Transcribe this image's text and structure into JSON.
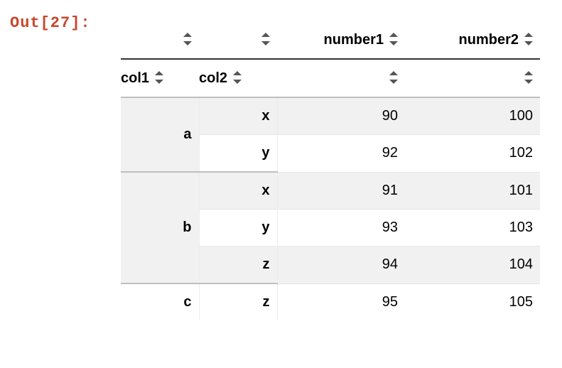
{
  "out_label": "Out[27]:",
  "header": {
    "top": {
      "blank1": "",
      "blank2": "",
      "number1": "number1",
      "number2": "number2"
    },
    "sub": {
      "col1": "col1",
      "col2": "col2",
      "blank1": "",
      "blank2": ""
    }
  },
  "rows": [
    {
      "col1": "a",
      "col2": "x",
      "number1": 90,
      "number2": 100,
      "stripe": true,
      "first_of_group": true,
      "group_rowspan": 2,
      "outer_divider": false
    },
    {
      "col1": "",
      "col2": "y",
      "number1": 92,
      "number2": 102,
      "stripe": false,
      "first_of_group": false,
      "group_rowspan": 0,
      "outer_divider": false
    },
    {
      "col1": "b",
      "col2": "x",
      "number1": 91,
      "number2": 101,
      "stripe": true,
      "first_of_group": true,
      "group_rowspan": 3,
      "outer_divider": true
    },
    {
      "col1": "",
      "col2": "y",
      "number1": 93,
      "number2": 103,
      "stripe": false,
      "first_of_group": false,
      "group_rowspan": 0,
      "outer_divider": false
    },
    {
      "col1": "",
      "col2": "z",
      "number1": 94,
      "number2": 104,
      "stripe": true,
      "first_of_group": false,
      "group_rowspan": 0,
      "outer_divider": false
    },
    {
      "col1": "c",
      "col2": "z",
      "number1": 95,
      "number2": 105,
      "stripe": false,
      "first_of_group": true,
      "group_rowspan": 1,
      "outer_divider": true
    }
  ],
  "chart_data": {
    "type": "table",
    "index_names": [
      "col1",
      "col2"
    ],
    "columns": [
      "number1",
      "number2"
    ],
    "records": [
      {
        "col1": "a",
        "col2": "x",
        "number1": 90,
        "number2": 100
      },
      {
        "col1": "a",
        "col2": "y",
        "number1": 92,
        "number2": 102
      },
      {
        "col1": "b",
        "col2": "x",
        "number1": 91,
        "number2": 101
      },
      {
        "col1": "b",
        "col2": "y",
        "number1": 93,
        "number2": 103
      },
      {
        "col1": "b",
        "col2": "z",
        "number1": 94,
        "number2": 104
      },
      {
        "col1": "c",
        "col2": "z",
        "number1": 95,
        "number2": 105
      }
    ]
  }
}
